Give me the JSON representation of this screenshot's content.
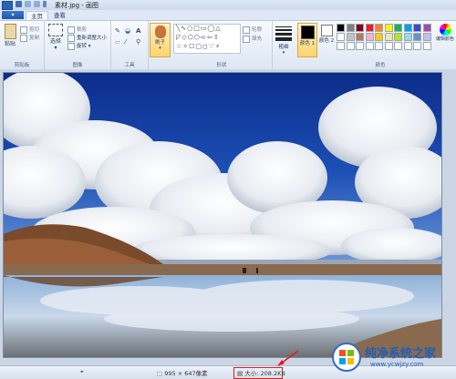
{
  "window": {
    "title": "素材.jpg - 画图"
  },
  "tabs": [
    {
      "label": "主页"
    },
    {
      "label": "查看"
    }
  ],
  "groups": {
    "clipboard": {
      "label": "剪贴板",
      "paste": "粘贴",
      "cut": "剪切",
      "copy": "复制"
    },
    "image": {
      "label": "图像",
      "select": "选择",
      "crop": "裁剪",
      "resize": "重新调整大小",
      "rotate": "旋转"
    },
    "tools": {
      "label": "工具"
    },
    "brush": {
      "label": "刷子"
    },
    "shapes": {
      "label": "形状",
      "outline": "轮廓",
      "fill": "填充"
    },
    "size": {
      "label": "粗细"
    },
    "colors": {
      "label": "颜色",
      "color1": "颜色 1",
      "color2": "颜色 2",
      "edit": "编辑颜色",
      "color1_value": "#000000",
      "color2_value": "#ffffff",
      "palette_row1": [
        "#000000",
        "#7f7f7f",
        "#880015",
        "#ed1c24",
        "#ff7f27",
        "#fff200",
        "#22b14c",
        "#00a2e8",
        "#3f48cc",
        "#a349a4"
      ],
      "palette_row2": [
        "#ffffff",
        "#c3c3c3",
        "#b97a57",
        "#ffaec9",
        "#ffc90e",
        "#efe4b0",
        "#b5e61d",
        "#99d9ea",
        "#7092be",
        "#c8bfe7"
      ]
    }
  },
  "status": {
    "dimensions": "995 × 647像素",
    "file_size": "大小: 208.2KB",
    "annotation_color": "#e01b1b"
  },
  "watermark": {
    "title": "纯净系统之家",
    "url": "www.ycwjzy.com"
  }
}
